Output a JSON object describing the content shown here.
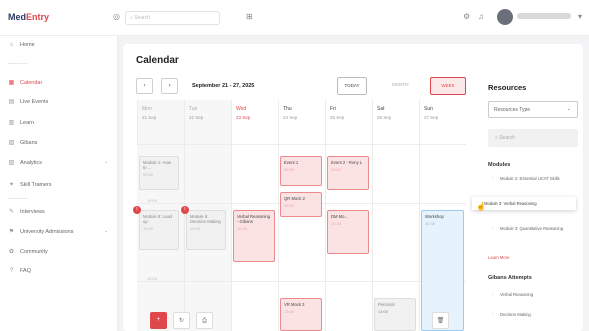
{
  "topbar": {
    "logo_main": "Med",
    "logo_accent": "Entry",
    "search_placeholder": "Search",
    "icons": [
      "globe-icon",
      "search-icon",
      "expand-icon",
      "bell-icon",
      "settings-icon"
    ]
  },
  "sidebar": {
    "items": [
      {
        "label": "Home",
        "icon": "⌂"
      },
      {
        "label": "Calendar",
        "icon": "▦",
        "active": true
      },
      {
        "label": "Live Events",
        "icon": "▤"
      },
      {
        "label": "Learn",
        "icon": "▥"
      },
      {
        "label": "Gibans",
        "icon": "▧"
      },
      {
        "label": "Analytics",
        "icon": "▨"
      },
      {
        "label": "Skill Trainers",
        "icon": "✦"
      },
      {
        "label": "Interviews",
        "icon": "✎"
      },
      {
        "label": "University Admissions",
        "icon": "⚑"
      },
      {
        "label": "Community",
        "icon": "✿"
      },
      {
        "label": "FAQ",
        "icon": "?"
      }
    ]
  },
  "calendar": {
    "title": "Calendar",
    "prev": "‹",
    "next": "›",
    "date_range": "September 21 - 27, 2025",
    "today": "TODAY",
    "month": "MONTH",
    "week": "WEEK",
    "days": [
      {
        "name": "Mon",
        "date": "21 Sep"
      },
      {
        "name": "Tue",
        "date": "22 Sep"
      },
      {
        "name": "Wed",
        "date": "23 Sep"
      },
      {
        "name": "Thu",
        "date": "24 Sep"
      },
      {
        "name": "Fri",
        "date": "25 Sep"
      },
      {
        "name": "Sat",
        "date": "26 Sep"
      },
      {
        "name": "Sun",
        "date": "27 Sep"
      }
    ],
    "times": [
      "10:00",
      "12:00"
    ],
    "events": {
      "mon1": {
        "title": "Module 1: How to ...",
        "time": "09:00"
      },
      "mon2": {
        "title": "Module 8: Lead up",
        "time": "10:00"
      },
      "tue1": {
        "title": "Module 9: Decision Making",
        "time": "10:00"
      },
      "wed1": {
        "title": "Verbal Reasoning - Gibans",
        "time": "10:30"
      },
      "thu1": {
        "title": "Event 1",
        "time": "09:00"
      },
      "thu2": {
        "title": "QR Mock 2",
        "time": "09:30"
      },
      "fri1": {
        "title": "Event 2 - Rony L",
        "time": "09:00"
      },
      "fri2": {
        "title": "DM Mo...",
        "time": "10:30"
      },
      "sun1": {
        "title": "Workshop",
        "time": "10:30"
      },
      "thu3": {
        "title": "VR Mock 3",
        "time": "13:00"
      },
      "sat1": {
        "title": "Personal",
        "time": "13:00"
      }
    },
    "badge": "!"
  },
  "resources": {
    "title": "Resources",
    "select_label": "Resources Type",
    "search_placeholder": "Search",
    "modules_heading": "Modules",
    "modules": [
      "Module 2: Essential UCAT Skills",
      "Module 3: Verbal Reasoning",
      "Module 3: Quantitative Reasoning"
    ],
    "learn_more": "Learn More",
    "gibans_heading": "Gibans Attempts",
    "gibans": [
      "Verbal Reasoning",
      "Decision Making"
    ]
  },
  "colors": {
    "accent": "#e0474c",
    "event_blue": "#e6f2fc",
    "event_red": "#fbe3e4"
  }
}
